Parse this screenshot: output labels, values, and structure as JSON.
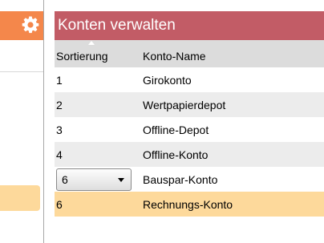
{
  "sidebar": {
    "accent_color": "#f4874b",
    "active_color": "#fdd99b",
    "settings_icon": "gear-icon"
  },
  "panel": {
    "title": "Konten verwalten",
    "title_color": "#c25c66"
  },
  "table": {
    "columns": [
      "Sortierung",
      "Konto-Name"
    ],
    "sort_indicator": "ascending",
    "rows": [
      {
        "order": "1",
        "name": "Girokonto"
      },
      {
        "order": "2",
        "name": "Wertpapierdepot"
      },
      {
        "order": "3",
        "name": "Offline-Depot"
      },
      {
        "order": "4",
        "name": "Offline-Konto"
      },
      {
        "order": "6",
        "name": "Bauspar-Konto",
        "editing": true
      },
      {
        "order": "6",
        "name": "Rechnungs-Konto",
        "selected": true
      }
    ]
  }
}
